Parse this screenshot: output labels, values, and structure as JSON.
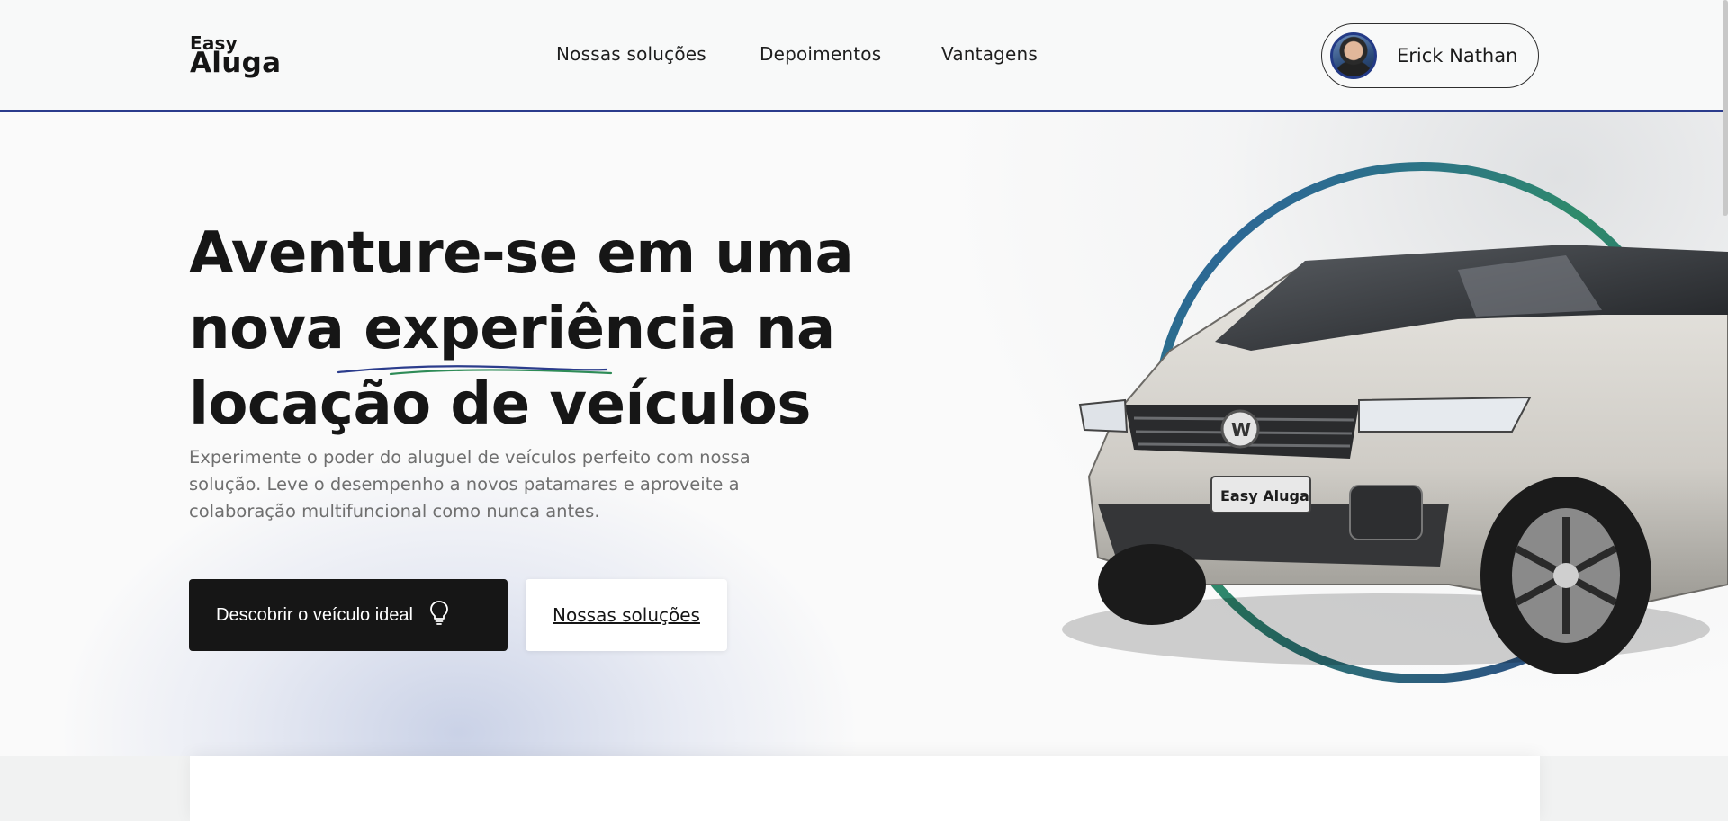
{
  "brand": {
    "logo_small": "Easy",
    "logo_big": "Aluga"
  },
  "nav": {
    "items": [
      {
        "label": "Nossas soluções"
      },
      {
        "label": "Depoimentos"
      },
      {
        "label": "Vantagens"
      }
    ]
  },
  "user": {
    "name": "Erick Nathan",
    "avatar_icon": "user-avatar-photo"
  },
  "hero": {
    "title_line1": "Aventure-se em uma",
    "title_line2_before": "nova ",
    "title_line2_highlight": "experiência",
    "title_line2_after": " na",
    "title_line3": "locação de veículos",
    "description": "Experimente o poder do aluguel de veículos perfeito com nossa solução. Leve o desempenho a novos patamares e aproveite a colaboração multifuncional como nunca antes.",
    "primary_button": "Descobrir o veículo ideal",
    "primary_button_icon": "lightbulb-icon",
    "secondary_button": "Nossas soluções"
  },
  "car": {
    "plate_text": "Easy Aluga"
  },
  "colors": {
    "accent_blue": "#2b3c8c",
    "accent_green": "#2e8b57",
    "dark": "#161616",
    "text_muted": "#6f6f6f"
  }
}
